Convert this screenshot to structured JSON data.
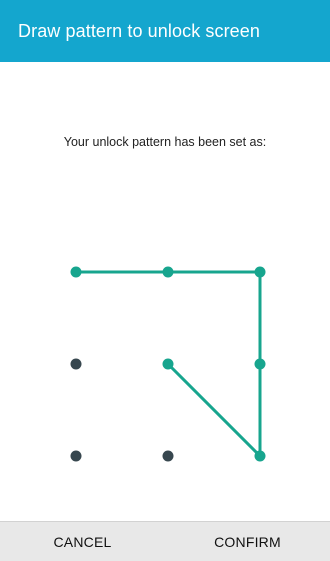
{
  "header": {
    "title": "Draw pattern to unlock screen"
  },
  "main": {
    "message": "Your unlock pattern has been set as:"
  },
  "pattern": {
    "grid": "3x3",
    "sequence": [
      1,
      2,
      3,
      6,
      9,
      5
    ],
    "line_color": "#17a58e",
    "active_dot_color": "#17a58e",
    "inactive_dot_color": "#37474f"
  },
  "footer": {
    "cancel_label": "CANCEL",
    "confirm_label": "CONFIRM"
  },
  "colors": {
    "accent": "#14a6ce",
    "bottom_bar": "#e8e8e8"
  }
}
